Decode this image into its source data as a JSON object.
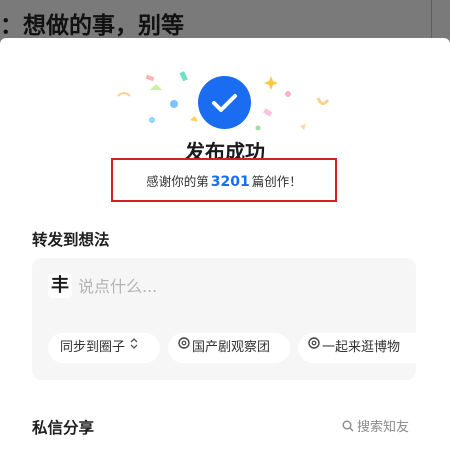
{
  "background": {
    "title": "：想做的事，别等"
  },
  "modal": {
    "title": "发布成功",
    "thanks": {
      "prefix": "感谢你的第",
      "count": "3201",
      "suffix": "篇创作！"
    }
  },
  "forward": {
    "title": "转发到想法",
    "avatar_glyph": "丰",
    "input_placeholder": "说点什么...",
    "chips": [
      {
        "label": "同步到圈子",
        "icon": "chevron-updown-icon"
      },
      {
        "label": "国产剧观察团",
        "icon": "circle-icon"
      },
      {
        "label": "一起来逛博物",
        "icon": "circle-icon"
      }
    ]
  },
  "dm": {
    "title": "私信分享",
    "search_label": "搜索知友",
    "search_icon": "search-icon"
  },
  "colors": {
    "accent": "#1a6cf0",
    "highlight_border": "#d21f1f",
    "overlay": "#7a7a7a"
  }
}
